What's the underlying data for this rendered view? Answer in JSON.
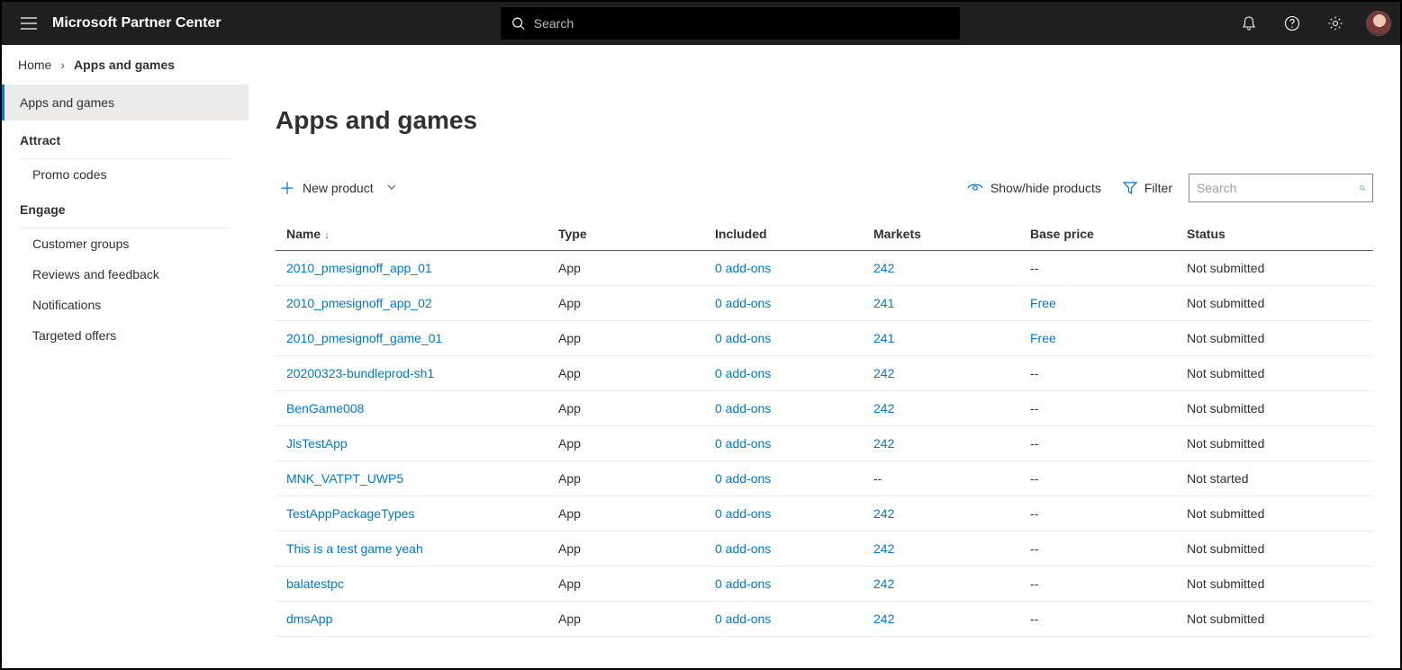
{
  "header": {
    "brand": "Microsoft Partner Center",
    "search_placeholder": "Search"
  },
  "breadcrumb": {
    "home": "Home",
    "current": "Apps and games"
  },
  "sidebar": {
    "active": "Apps and games",
    "sections": [
      {
        "label": "Attract",
        "items": [
          "Promo codes"
        ]
      },
      {
        "label": "Engage",
        "items": [
          "Customer groups",
          "Reviews and feedback",
          "Notifications",
          "Targeted offers"
        ]
      }
    ]
  },
  "page": {
    "title": "Apps and games",
    "new_product": "New product",
    "show_hide": "Show/hide products",
    "filter": "Filter",
    "table_search_placeholder": "Search"
  },
  "table": {
    "columns": {
      "name": "Name",
      "type": "Type",
      "included": "Included",
      "markets": "Markets",
      "base_price": "Base price",
      "status": "Status"
    },
    "rows": [
      {
        "name": "2010_pmesignoff_app_01",
        "type": "App",
        "included": "0 add-ons",
        "markets": "242",
        "base_price": "--",
        "status": "Not submitted"
      },
      {
        "name": "2010_pmesignoff_app_02",
        "type": "App",
        "included": "0 add-ons",
        "markets": "241",
        "base_price": "Free",
        "status": "Not submitted"
      },
      {
        "name": "2010_pmesignoff_game_01",
        "type": "App",
        "included": "0 add-ons",
        "markets": "241",
        "base_price": "Free",
        "status": "Not submitted"
      },
      {
        "name": "20200323-bundleprod-sh1",
        "type": "App",
        "included": "0 add-ons",
        "markets": "242",
        "base_price": "--",
        "status": "Not submitted"
      },
      {
        "name": "BenGame008",
        "type": "App",
        "included": "0 add-ons",
        "markets": "242",
        "base_price": "--",
        "status": "Not submitted"
      },
      {
        "name": "JlsTestApp",
        "type": "App",
        "included": "0 add-ons",
        "markets": "242",
        "base_price": "--",
        "status": "Not submitted"
      },
      {
        "name": "MNK_VATPT_UWP5",
        "type": "App",
        "included": "0 add-ons",
        "markets": "--",
        "base_price": "--",
        "status": "Not started"
      },
      {
        "name": "TestAppPackageTypes",
        "type": "App",
        "included": "0 add-ons",
        "markets": "242",
        "base_price": "--",
        "status": "Not submitted"
      },
      {
        "name": "This is a test game yeah",
        "type": "App",
        "included": "0 add-ons",
        "markets": "242",
        "base_price": "--",
        "status": "Not submitted"
      },
      {
        "name": "balatestpc",
        "type": "App",
        "included": "0 add-ons",
        "markets": "242",
        "base_price": "--",
        "status": "Not submitted"
      },
      {
        "name": "dmsApp",
        "type": "App",
        "included": "0 add-ons",
        "markets": "242",
        "base_price": "--",
        "status": "Not submitted"
      }
    ]
  }
}
